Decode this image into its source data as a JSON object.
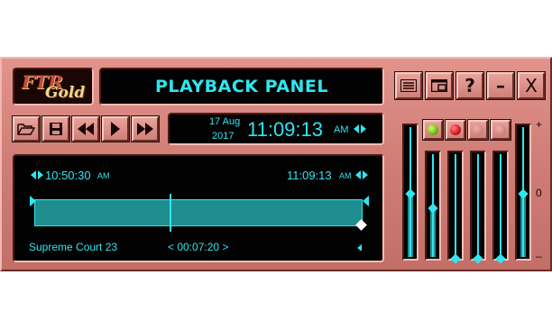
{
  "logo": {
    "text_top": "FTR",
    "text_bottom": "Gold"
  },
  "title": "PLAYBACK PANEL",
  "window_buttons": {
    "menu_icon": "menu-list-icon",
    "restore_icon": "window-restore-icon",
    "help": "?",
    "minimize": "–",
    "close": "X"
  },
  "transport": {
    "open": "folder-open-icon",
    "save": "disk-save-icon",
    "rewind": "rewind-icon",
    "play": "play-icon",
    "fast_forward": "fast-forward-icon"
  },
  "clock": {
    "date_day": "17 Aug",
    "date_year": "2017",
    "time": "11:09:13",
    "ampm": "AM"
  },
  "timeline": {
    "start_time": "10:50:30",
    "start_ampm": "AM",
    "end_time": "11:09:13",
    "end_ampm": "AM",
    "room": "Supreme Court 23",
    "duration": "< 00:07:20 >"
  },
  "mixer": {
    "plus_label": "+",
    "zero_label": "0",
    "minus_label": "–"
  },
  "indicators": [
    {
      "name": "green-led",
      "color": "#7fc81a"
    },
    {
      "name": "red-led",
      "color": "#e4202a"
    },
    {
      "name": "off-led",
      "color": "#d08a82"
    },
    {
      "name": "off-led",
      "color": "#d08a82"
    }
  ],
  "colors": {
    "accent": "#2fe6ee",
    "panel": "#cf7d75",
    "screen": "#020202",
    "bar": "#1e8e90"
  }
}
